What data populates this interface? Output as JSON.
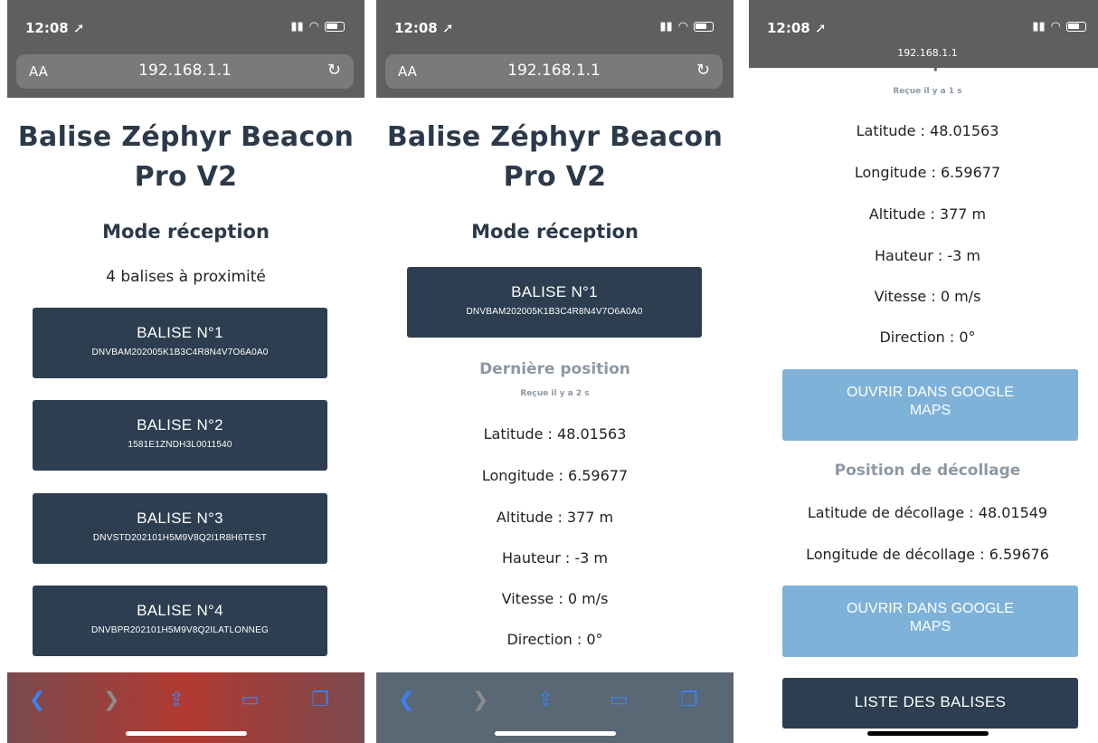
{
  "status": {
    "time": "12:08",
    "url": "192.168.1.1",
    "aa": "AA"
  },
  "title": "Balise Zéphyr Beacon Pro V2",
  "title_line1": "Balise Zéphyr Beacon",
  "title_line2": "Pro V2",
  "mode": "Mode réception",
  "screen1": {
    "count_text": "4 balises à proximité",
    "beacons": [
      {
        "name": "BALISE N°1",
        "id": "DNVBAM202005K1B3C4R8N4V7O6A0A0"
      },
      {
        "name": "BALISE N°2",
        "id": "1581E1ZNDH3L0011540"
      },
      {
        "name": "BALISE N°3",
        "id": "DNVSTD202101H5M9V8Q2I1R8H6TEST"
      },
      {
        "name": "BALISE N°4",
        "id": "DNVBPR202101H5M9V8Q2ILATLONNEG"
      }
    ]
  },
  "screen2": {
    "beacon": {
      "name": "BALISE N°1",
      "id": "DNVBAM202005K1B3C4R8N4V7O6A0A0"
    },
    "last_position": "Dernière position",
    "received": "Reçue il y a 2 s",
    "latitude": "Latitude : 48.01563",
    "longitude": "Longitude : 6.59677",
    "altitude": "Altitude : 377 m",
    "height": "Hauteur : -3 m",
    "speed": "Vitesse : 0 m/s",
    "direction": "Direction : 0°"
  },
  "screen3": {
    "last_position_partial": "Dernière position",
    "received": "Reçue il y a 1 s",
    "latitude": "Latitude : 48.01563",
    "longitude": "Longitude : 6.59677",
    "altitude": "Altitude : 377 m",
    "height": "Hauteur : -3 m",
    "speed": "Vitesse : 0 m/s",
    "direction": "Direction : 0°",
    "open_maps_1_line1": "OUVRIR DANS GOOGLE",
    "open_maps_1_line2": "MAPS",
    "takeoff_title": "Position de décollage",
    "takeoff_lat": "Latitude de décollage : 48.01549",
    "takeoff_lon": "Longitude de décollage : 6.59676",
    "open_maps_2_line1": "OUVRIR DANS GOOGLE",
    "open_maps_2_line2": "MAPS",
    "list_button": "LISTE DES BALISES"
  },
  "icons": [
    "back-icon",
    "forward-icon",
    "share-icon",
    "bookmarks-icon",
    "tabs-icon",
    "reload-icon",
    "wifi-icon",
    "signal-icon",
    "battery-icon",
    "location-icon"
  ],
  "colors": {
    "dark_button": "#2c3e50",
    "light_button": "#7eb2d8",
    "heading": "#2b3a4a",
    "muted": "#8d98a4",
    "toolbar_blue": "#3b82f6"
  }
}
